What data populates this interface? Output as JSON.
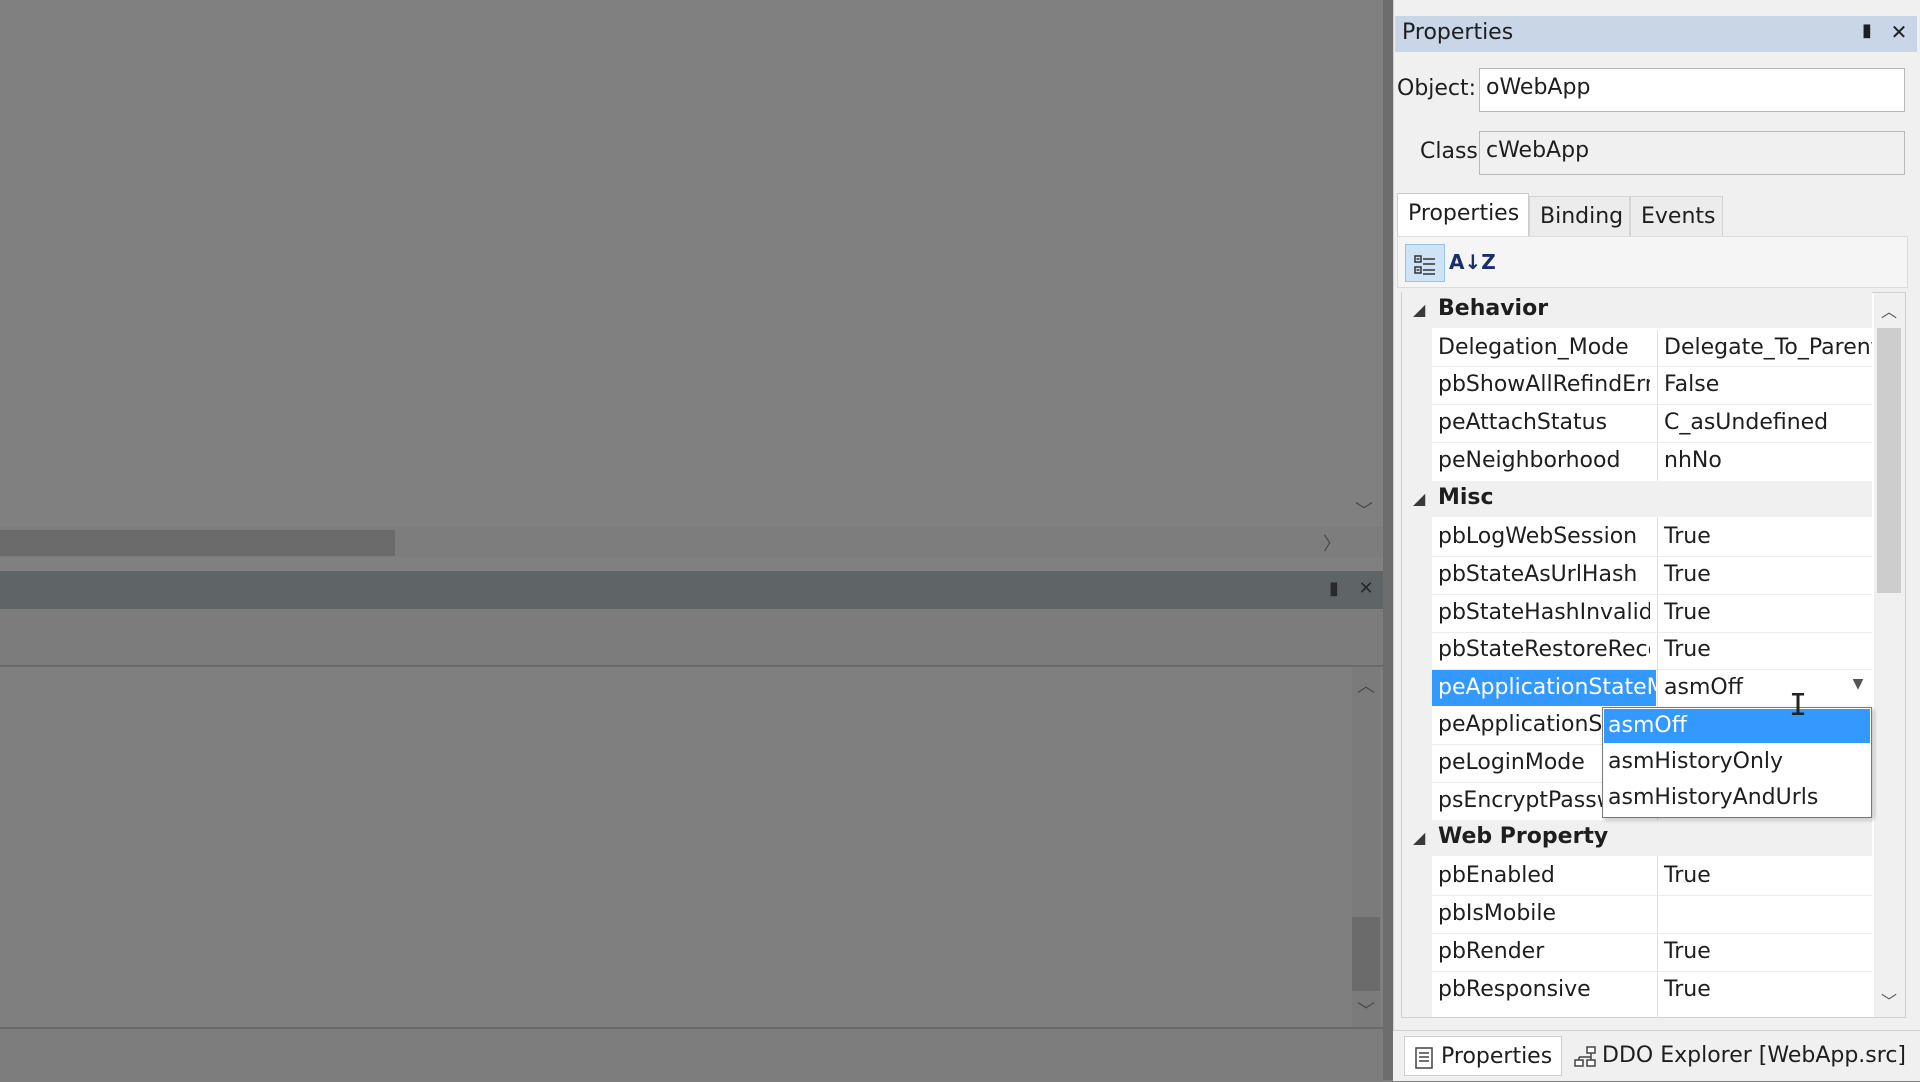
{
  "panel": {
    "title": "Properties",
    "pin_icon": "pin-icon",
    "close_icon": "close-icon"
  },
  "object": {
    "label": "Object:",
    "value": "oWebApp"
  },
  "class": {
    "label": "Class",
    "value": "cWebApp"
  },
  "tabs": [
    {
      "label": "Properties",
      "active": true
    },
    {
      "label": "Binding",
      "active": false
    },
    {
      "label": "Events",
      "active": false
    }
  ],
  "toolbar": {
    "categorized_icon": "categorized-icon",
    "alphabetical_icon": "sort-az-icon",
    "alphabetical_glyph": "A↓Z"
  },
  "grid": {
    "categories": [
      {
        "label": "Behavior",
        "rows": [
          {
            "name": "Delegation_Mode",
            "value": "Delegate_To_Parent"
          },
          {
            "name": "pbShowAllRefindErrc",
            "value": "False"
          },
          {
            "name": "peAttachStatus",
            "value": "C_asUndefined"
          },
          {
            "name": "peNeighborhood",
            "value": "nhNo"
          }
        ]
      },
      {
        "label": "Misc",
        "rows": [
          {
            "name": "pbLogWebSession",
            "value": "True"
          },
          {
            "name": "pbStateAsUrlHash",
            "value": "True"
          },
          {
            "name": "pbStateHashInvalidE",
            "value": "True"
          },
          {
            "name": "pbStateRestoreRecor",
            "value": "True"
          },
          {
            "name": "peApplicationStateM",
            "value": "asmOff",
            "selected": true
          },
          {
            "name": "peApplicationSt",
            "value": ""
          },
          {
            "name": "peLoginMode",
            "value": ""
          },
          {
            "name": "psEncryptPassw",
            "value": ""
          }
        ]
      },
      {
        "label": "Web Property",
        "rows": [
          {
            "name": "pbEnabled",
            "value": "True"
          },
          {
            "name": "pbIsMobile",
            "value": ""
          },
          {
            "name": "pbRender",
            "value": "True"
          },
          {
            "name": "pbResponsive",
            "value": "True"
          }
        ]
      }
    ]
  },
  "dropdown": {
    "options": [
      "asmOff",
      "asmHistoryOnly",
      "asmHistoryAndUrls"
    ],
    "selected": "asmOff"
  },
  "bottom_tabs": [
    {
      "label": "Properties",
      "icon": "properties-list-icon"
    },
    {
      "label": "DDO Explorer [WebApp.src]",
      "icon": "ddo-tree-icon"
    }
  ],
  "glyphs": {
    "expanded_arrow": "◢",
    "pin": "▮",
    "close": "✕",
    "scroll_up": "︿",
    "scroll_down": "﹀",
    "scroll_right": "〉",
    "dropdown_arrow": "▼",
    "ibeam": "I"
  },
  "colors": {
    "selection": "#3399ff",
    "title_bar": "#c8d6e8",
    "dimmed_background": "#808080"
  }
}
